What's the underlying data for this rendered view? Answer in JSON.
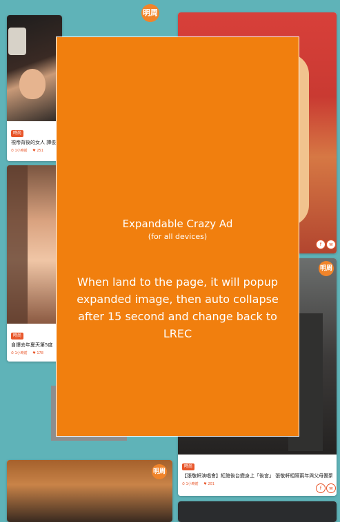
{
  "logo": {
    "text": "明周"
  },
  "cards": [
    {
      "tag": "時尚",
      "title": "視帝背後的女人 譚俊",
      "meta_time": "⏱ 1小時前",
      "meta_likes": "♥ 251"
    },
    {
      "tag": "時尚",
      "title": "自爆去年夏天第5度",
      "meta_time": "⏱ 1小時前",
      "meta_likes": "♥ 178"
    },
    {
      "tag": "時尚",
      "title": "【張敬軒演唱會】紅館後台變身上「後宮」 張敬軒相隔兩年與父母團聚",
      "meta_time": "⏱ 1小時前",
      "meta_likes": "♥ 201"
    }
  ],
  "share": {
    "facebook": "f",
    "whatsapp": "w"
  },
  "ad": {
    "title": "Expandable Crazy Ad",
    "subtitle": "(for all devices)",
    "body": "When land to the page, it will popup expanded image,  then auto collapse after 15 second and change back to LREC"
  },
  "colors": {
    "background": "#5fb3b8",
    "ad_orange": "#f17f0e",
    "accent": "#e8562a"
  }
}
